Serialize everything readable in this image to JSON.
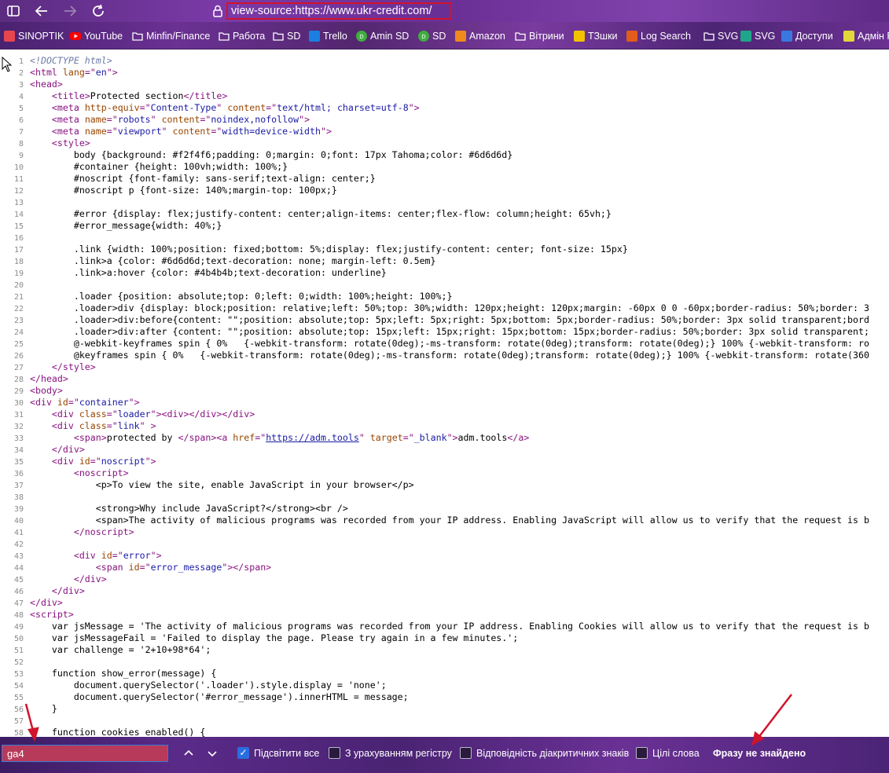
{
  "toolbar": {
    "url": "view-source:https://www.ukr-credit.com/",
    "buttons": [
      "sidebar-icon",
      "back-icon",
      "forward-icon",
      "refresh-icon"
    ]
  },
  "bookmarks": [
    {
      "label": "SINOPTIK",
      "icon": "thermometer-icon",
      "color": "#e8464e"
    },
    {
      "label": "YouTube",
      "icon": "youtube-icon",
      "color": "#ff0000"
    },
    {
      "label": "Minfin/Finance",
      "icon": "folder-icon",
      "color": "#ffffff"
    },
    {
      "label": "Работа",
      "icon": "folder-icon",
      "color": "#ffffff"
    },
    {
      "label": "SD",
      "icon": "folder-icon",
      "color": "#ffffff"
    },
    {
      "label": "Trello",
      "icon": "trello-icon",
      "color": "#1a7fe0"
    },
    {
      "label": "Amin SD",
      "icon": "sd-icon",
      "color": "#3fae3f"
    },
    {
      "label": "SD",
      "icon": "sd-icon",
      "color": "#3fae3f"
    },
    {
      "label": "Amazon",
      "icon": "amazon-icon",
      "color": "#f08a1c"
    },
    {
      "label": "Вітрини",
      "icon": "folder-icon",
      "color": "#ffffff"
    },
    {
      "label": "ТЗшки",
      "icon": "drive-icon",
      "color": "#f2c200"
    },
    {
      "label": "Log Search",
      "icon": "log-icon",
      "color": "#e25d1c"
    },
    {
      "label": "SVG",
      "icon": "folder-icon",
      "color": "#ffffff"
    },
    {
      "label": "SVG",
      "icon": "svg-icon",
      "color": "#1fa58a"
    },
    {
      "label": "Доступи",
      "icon": "docs-icon",
      "color": "#3a78e0"
    },
    {
      "label": "Адмін Р",
      "icon": "pen-icon",
      "color": "#e3d63a"
    }
  ],
  "code_lines": [
    [
      [
        "dt",
        "<!DOCTYPE html>"
      ]
    ],
    [
      [
        "tag",
        "<html "
      ],
      [
        "an",
        "lang"
      ],
      [
        "tag",
        "=\""
      ],
      [
        "av",
        "en"
      ],
      [
        "tag",
        "\">"
      ]
    ],
    [
      [
        "tag",
        "<head>"
      ]
    ],
    [
      [
        "",
        "    "
      ],
      [
        "tag",
        "<title>"
      ],
      [
        "",
        "Protected section"
      ],
      [
        "tag",
        "</title>"
      ]
    ],
    [
      [
        "",
        "    "
      ],
      [
        "tag",
        "<meta "
      ],
      [
        "an",
        "http-equiv"
      ],
      [
        "tag",
        "=\""
      ],
      [
        "av",
        "Content-Type"
      ],
      [
        "tag",
        "\" "
      ],
      [
        "an",
        "content"
      ],
      [
        "tag",
        "=\""
      ],
      [
        "av",
        "text/html; charset=utf-8"
      ],
      [
        "tag",
        "\">"
      ]
    ],
    [
      [
        "",
        "    "
      ],
      [
        "tag",
        "<meta "
      ],
      [
        "an",
        "name"
      ],
      [
        "tag",
        "=\""
      ],
      [
        "av",
        "robots"
      ],
      [
        "tag",
        "\" "
      ],
      [
        "an",
        "content"
      ],
      [
        "tag",
        "=\""
      ],
      [
        "av",
        "noindex,nofollow"
      ],
      [
        "tag",
        "\">"
      ]
    ],
    [
      [
        "",
        "    "
      ],
      [
        "tag",
        "<meta "
      ],
      [
        "an",
        "name"
      ],
      [
        "tag",
        "=\""
      ],
      [
        "av",
        "viewport"
      ],
      [
        "tag",
        "\" "
      ],
      [
        "an",
        "content"
      ],
      [
        "tag",
        "=\""
      ],
      [
        "av",
        "width=device-width"
      ],
      [
        "tag",
        "\">"
      ]
    ],
    [
      [
        "",
        "    "
      ],
      [
        "tag",
        "<style>"
      ]
    ],
    [
      [
        "",
        "        body {background: #f2f4f6;padding: 0;margin: 0;font: 17px Tahoma;color: #6d6d6d}"
      ]
    ],
    [
      [
        "",
        "        #container {height: 100vh;width: 100%;}"
      ]
    ],
    [
      [
        "",
        "        #noscript {font-family: sans-serif;text-align: center;}"
      ]
    ],
    [
      [
        "",
        "        #noscript p {font-size: 140%;margin-top: 100px;}"
      ]
    ],
    [
      [
        "",
        ""
      ]
    ],
    [
      [
        "",
        "        #error {display: flex;justify-content: center;align-items: center;flex-flow: column;height: 65vh;}"
      ]
    ],
    [
      [
        "",
        "        #error_message{width: 40%;}"
      ]
    ],
    [
      [
        "",
        ""
      ]
    ],
    [
      [
        "",
        "        .link {width: 100%;position: fixed;bottom: 5%;display: flex;justify-content: center; font-size: 15px}"
      ]
    ],
    [
      [
        "",
        "        .link>a {color: #6d6d6d;text-decoration: none; margin-left: 0.5em}"
      ]
    ],
    [
      [
        "",
        "        .link>a:hover {color: #4b4b4b;text-decoration: underline}"
      ]
    ],
    [
      [
        "",
        ""
      ]
    ],
    [
      [
        "",
        "        .loader {position: absolute;top: 0;left: 0;width: 100%;height: 100%;}"
      ]
    ],
    [
      [
        "",
        "        .loader>div {display: block;position: relative;left: 50%;top: 30%;width: 120px;height: 120px;margin: -60px 0 0 -60px;border-radius: 50%;border: 3"
      ]
    ],
    [
      [
        "",
        "        .loader>div:before{content: \"\";position: absolute;top: 5px;left: 5px;right: 5px;bottom: 5px;border-radius: 50%;border: 3px solid transparent;bord"
      ]
    ],
    [
      [
        "",
        "        .loader>div:after {content: \"\";position: absolute;top: 15px;left: 15px;right: 15px;bottom: 15px;border-radius: 50%;border: 3px solid transparent;"
      ]
    ],
    [
      [
        "",
        "        @-webkit-keyframes spin { 0%   {-webkit-transform: rotate(0deg);-ms-transform: rotate(0deg);transform: rotate(0deg);} 100% {-webkit-transform: ro"
      ]
    ],
    [
      [
        "",
        "        @keyframes spin { 0%   {-webkit-transform: rotate(0deg);-ms-transform: rotate(0deg);transform: rotate(0deg);} 100% {-webkit-transform: rotate(360"
      ]
    ],
    [
      [
        "",
        "    "
      ],
      [
        "tag",
        "</style>"
      ]
    ],
    [
      [
        "tag",
        "</head>"
      ]
    ],
    [
      [
        "tag",
        "<body>"
      ]
    ],
    [
      [
        "tag",
        "<div "
      ],
      [
        "an",
        "id"
      ],
      [
        "tag",
        "=\""
      ],
      [
        "av",
        "container"
      ],
      [
        "tag",
        "\">"
      ]
    ],
    [
      [
        "",
        "    "
      ],
      [
        "tag",
        "<div "
      ],
      [
        "an",
        "class"
      ],
      [
        "tag",
        "=\""
      ],
      [
        "av",
        "loader"
      ],
      [
        "tag",
        "\"><div></div></div>"
      ]
    ],
    [
      [
        "",
        "    "
      ],
      [
        "tag",
        "<div "
      ],
      [
        "an",
        "class"
      ],
      [
        "tag",
        "=\""
      ],
      [
        "av",
        "link"
      ],
      [
        "tag",
        "\" >"
      ]
    ],
    [
      [
        "",
        "        "
      ],
      [
        "tag",
        "<span>"
      ],
      [
        "",
        "protected by "
      ],
      [
        "tag",
        "</span><a "
      ],
      [
        "an",
        "href"
      ],
      [
        "tag",
        "=\""
      ],
      [
        "lnk",
        "https://adm.tools"
      ],
      [
        "tag",
        "\" "
      ],
      [
        "an",
        "target"
      ],
      [
        "tag",
        "=\""
      ],
      [
        "av",
        "_blank"
      ],
      [
        "tag",
        "\">"
      ],
      [
        "",
        "adm.tools"
      ],
      [
        "tag",
        "</a>"
      ]
    ],
    [
      [
        "",
        "    "
      ],
      [
        "tag",
        "</div>"
      ]
    ],
    [
      [
        "",
        "    "
      ],
      [
        "tag",
        "<div "
      ],
      [
        "an",
        "id"
      ],
      [
        "tag",
        "=\""
      ],
      [
        "av",
        "noscript"
      ],
      [
        "tag",
        "\">"
      ]
    ],
    [
      [
        "",
        "        "
      ],
      [
        "tag",
        "<noscript>"
      ]
    ],
    [
      [
        "",
        "            <p>To view the site, enable JavaScript in your browser</p>"
      ]
    ],
    [
      [
        "",
        ""
      ]
    ],
    [
      [
        "",
        "            <strong>Why include JavaScript?</strong><br />"
      ]
    ],
    [
      [
        "",
        "            <span>The activity of malicious programs was recorded from your IP address. Enabling JavaScript will allow us to verify that the request is b"
      ]
    ],
    [
      [
        "",
        "        "
      ],
      [
        "tag",
        "</noscript>"
      ]
    ],
    [
      [
        "",
        ""
      ]
    ],
    [
      [
        "",
        "        "
      ],
      [
        "tag",
        "<div "
      ],
      [
        "an",
        "id"
      ],
      [
        "tag",
        "=\""
      ],
      [
        "av",
        "error"
      ],
      [
        "tag",
        "\">"
      ]
    ],
    [
      [
        "",
        "            "
      ],
      [
        "tag",
        "<span "
      ],
      [
        "an",
        "id"
      ],
      [
        "tag",
        "=\""
      ],
      [
        "av",
        "error_message"
      ],
      [
        "tag",
        "\"></span>"
      ]
    ],
    [
      [
        "",
        "        "
      ],
      [
        "tag",
        "</div>"
      ]
    ],
    [
      [
        "",
        "    "
      ],
      [
        "tag",
        "</div>"
      ]
    ],
    [
      [
        "tag",
        "</div>"
      ]
    ],
    [
      [
        "tag",
        "<script>"
      ]
    ],
    [
      [
        "",
        "    var jsMessage = 'The activity of malicious programs was recorded from your IP address. Enabling Cookies will allow us to verify that the request is b"
      ]
    ],
    [
      [
        "",
        "    var jsMessageFail = 'Failed to display the page. Please try again in a few minutes.';"
      ]
    ],
    [
      [
        "",
        "    var challenge = '2+10+98*64';"
      ]
    ],
    [
      [
        "",
        ""
      ]
    ],
    [
      [
        "",
        "    function show_error(message) {"
      ]
    ],
    [
      [
        "",
        "        document.querySelector('.loader').style.display = 'none';"
      ]
    ],
    [
      [
        "",
        "        document.querySelector('#error_message').innerHTML = message;"
      ]
    ],
    [
      [
        "",
        "    }"
      ]
    ],
    [
      [
        "",
        ""
      ]
    ],
    [
      [
        "",
        "    function cookies_enabled() {"
      ]
    ]
  ],
  "findbar": {
    "query": "ga4",
    "options": [
      {
        "label": "Підсвітити все",
        "checked": true
      },
      {
        "label": "З урахуванням регістру",
        "checked": false
      },
      {
        "label": "Відповідність діакритичних знаків",
        "checked": false
      },
      {
        "label": "Цілі слова",
        "checked": false
      }
    ],
    "status": "Фразу не знайдено"
  }
}
